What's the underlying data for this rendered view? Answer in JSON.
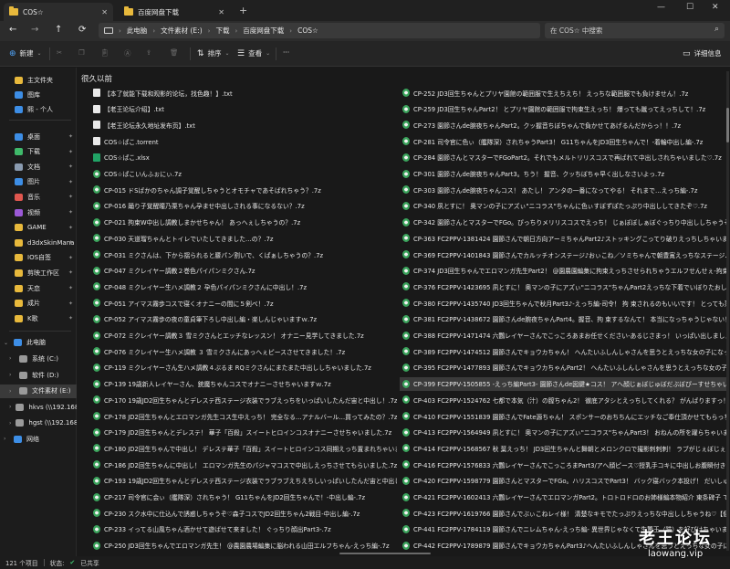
{
  "tabs": [
    {
      "label": "COS☆",
      "active": true
    },
    {
      "label": "百度网盘下载",
      "active": false
    }
  ],
  "window_controls": {
    "minimize": "—",
    "maximize": "☐",
    "close": "✕"
  },
  "nav": {
    "back": "←",
    "forward": "→",
    "up": "↑",
    "refresh": "⟳"
  },
  "breadcrumb": [
    "此电脑",
    "文件素材 (E:)",
    "下载",
    "百度网盘下载",
    "COS☆"
  ],
  "search": {
    "placeholder": "在 COS☆ 中搜索"
  },
  "commands": {
    "new": "新建",
    "sort": "排序",
    "view": "查看",
    "more": "···",
    "details": "详细信息"
  },
  "sidebar": {
    "quick": [
      {
        "label": "主文件夹",
        "icon": "home-icon",
        "color": "#e8b93c"
      },
      {
        "label": "图库",
        "icon": "gallery-icon",
        "color": "#3d8ee6"
      },
      {
        "label": "熙 - 个人",
        "icon": "onedrive-icon",
        "color": "#3d8ee6"
      }
    ],
    "pinned": [
      {
        "label": "桌面",
        "icon": "desktop-icon",
        "color": "#3d8ee6"
      },
      {
        "label": "下载",
        "icon": "download-icon",
        "color": "#3fb96a"
      },
      {
        "label": "文档",
        "icon": "documents-icon",
        "color": "#8a9bb0"
      },
      {
        "label": "图片",
        "icon": "pictures-icon",
        "color": "#3d8ee6"
      },
      {
        "label": "音乐",
        "icon": "music-icon",
        "color": "#e0574f"
      },
      {
        "label": "视频",
        "icon": "videos-icon",
        "color": "#9b59d6"
      },
      {
        "label": "GAME",
        "icon": "folder-icon",
        "color": "#e8b93c"
      },
      {
        "label": "d3dxSkinMana",
        "icon": "folder-icon",
        "color": "#e8b93c"
      },
      {
        "label": "IOS自签",
        "icon": "folder-icon",
        "color": "#e8b93c"
      },
      {
        "label": "剪映工作区",
        "icon": "folder-icon",
        "color": "#e8b93c"
      },
      {
        "label": "天恋",
        "icon": "folder-icon",
        "color": "#e8b93c"
      },
      {
        "label": "成片",
        "icon": "folder-icon",
        "color": "#e8b93c"
      },
      {
        "label": "K歌",
        "icon": "folder-icon",
        "color": "#e8b93c"
      }
    ],
    "devices": [
      {
        "label": "此电脑",
        "icon": "pc-icon",
        "color": "#3d8ee6",
        "expanded": true
      },
      {
        "label": "系统 (C:)",
        "icon": "drive-icon",
        "color": "#9a9a9a"
      },
      {
        "label": "软件 (D:)",
        "icon": "drive-icon",
        "color": "#9a9a9a"
      },
      {
        "label": "文件素材 (E:)",
        "icon": "drive-icon",
        "color": "#9a9a9a",
        "selected": true
      },
      {
        "label": "hkvs (\\\\192.168.",
        "icon": "network-drive-icon",
        "color": "#9a9a9a"
      },
      {
        "label": "hgst (\\\\192.168.",
        "icon": "network-drive-icon",
        "color": "#9a9a9a"
      },
      {
        "label": "网络",
        "icon": "network-icon",
        "color": "#3d8ee6"
      }
    ]
  },
  "group_header": "很久以前",
  "files_left": [
    {
      "name": "【本了就能下载和观影的论坛，找色趣！】.txt",
      "type": "doc"
    },
    {
      "name": "【老王论坛介绍】.txt",
      "type": "doc"
    },
    {
      "name": "【老王论坛永久地址发布页】.txt",
      "type": "doc"
    },
    {
      "name": "COS☆ぱこ.torrent",
      "type": "doc"
    },
    {
      "name": "COS☆ぱこ.xlsx",
      "type": "xlsx"
    },
    {
      "name": "COS☆ぱこいんふぉにぃ.7z",
      "type": "gear"
    },
    {
      "name": "CP-015 ドSばかのちゃん調子覚醒しちゃうとオモチャであそばれちゃう？.7z",
      "type": "gear"
    },
    {
      "name": "CP-016 踊り子覚醒瞳乃栗ちゃん孕ませ中出しされる事になるない？.7z",
      "type": "gear"
    },
    {
      "name": "CP-021 拘束W中出し調教しまかせちゃん！ あっへぇしちゃうの？.7z",
      "type": "gear"
    },
    {
      "name": "CP-030 天道瑠ちゃんとトイレでいたしてきました…の？.7z",
      "type": "gear"
    },
    {
      "name": "CP-031 ミクさんは、下から揺られると腰パン割いで、くぱぁしちゃうの？.7z",
      "type": "gear"
    },
    {
      "name": "CP-047 ミクレイヤー調教２巻色パイパンミクさん.7z",
      "type": "gear"
    },
    {
      "name": "CP-048 ミクレイヤー生ハメ調教２ 孕色パイパンミクさんに中出し！.7z",
      "type": "gear"
    },
    {
      "name": "CP-051 アイマス霧歩コスで寝くオナニーの間に５剣べ！.7z",
      "type": "gear"
    },
    {
      "name": "CP-052 アイマス霧歩の夜の童貞筆下ろし中出し編・楽しんじゃいますｗ.7z",
      "type": "gear"
    },
    {
      "name": "CP-072 ミクレイヤー調教３ 雪ミクさんとエッチなレッスン！ オナニー見学してきました.7z",
      "type": "gear"
    },
    {
      "name": "CP-076 ミクレイヤー生ハメ調教 ３ 雪ミクさんにあっへぇピースさせてきました！.7z",
      "type": "gear"
    },
    {
      "name": "CP-119 ミクレイヤーさん生ハメ調教４ぶるま RQミクさんにまたまた中出ししちゃいました.7z",
      "type": "gear"
    },
    {
      "name": "CP-139 19歳新人レイヤーさん、銃魔ちゃんコスでオナニーさせちゃいますｗ.7z",
      "type": "gear"
    },
    {
      "name": "CP-170 19歳JD2回生ちゃんとデレステ西ステージ衣装でラブえっちをいっぱいしたんだ宙と中出し！.7z",
      "type": "gear"
    },
    {
      "name": "CP-178 JD2回生ちゃんとエロマンガ先生コス生中えっち！ 完全なる…アナルバール…買ってみたの？.7z",
      "type": "gear"
    },
    {
      "name": "CP-179 JD2回生ちゃんとデレステ！ 華子「百殺」スイートヒロインコスオナニーさせちゃいました.7z",
      "type": "gear"
    },
    {
      "name": "CP-180 JD2回生ちゃんで中出し！ デレステ華子「百殺」スイートヒロインコス同期えっち置まれちゃいました.7z",
      "type": "gear"
    },
    {
      "name": "CP-186 JD2回生ちゃんに中出し！ エロマンガ先生のパジャマコスで中出しえっちさせてもらいました.7z",
      "type": "gear"
    },
    {
      "name": "CP-193 19歳JD2回生ちゃんとデレステ西ステージ衣装でラブラブえちえちしいっぱいしたんだ宙と中出し-Part2-1 .7z",
      "type": "gear"
    },
    {
      "name": "CP-217 司令官に会ぃ（艦隊深）されちゃう！ G11ちゃんをJD2回生ちゃんで！-中出し編-.7z",
      "type": "gear"
    },
    {
      "name": "CP-230 スク水中に仕込んで誘惑しちゃうぞ♡森子コスでJD2回生ちゃん2戦目-中出し編-.7z",
      "type": "gear"
    },
    {
      "name": "CP-233 イってる山風ちゃん酒かせて遊ばせて来ました！ ぐっちり顔出Part3-.7z",
      "type": "gear"
    },
    {
      "name": "CP-250 JD3回生ちゃんでエロマンガ先生！ @農園農場編集に脳われる山田エルフちゃん-えっち編-.7z",
      "type": "gear"
    }
  ],
  "files_right": [
    {
      "name": "CP-252 JD3回生ちゃんとプリヤ園館の範囲服で生えちえち！ えっちな範囲服でも負けません！.7z",
      "type": "gear"
    },
    {
      "name": "CP-259 JD3回生ちゃんPart2！ とプリヤ園館の範囲服で拘束生えっち！ 爆っても蹴ってえっちして！.7z",
      "type": "gear"
    },
    {
      "name": "CP-273 園節さんde腕夜ちゃんPart2。クッ握音ちぼちゃんで負かせてあげるんだからっ！！.7z",
      "type": "gear"
    },
    {
      "name": "CP-281 司令官に色ぃ（艦隊深）されちゃうPart3！ G11ちゃんをJD3回生ちゃんで！-着輪中出し編-.7z",
      "type": "gear"
    },
    {
      "name": "CP-284 園節さんとマスターでFGoPart2。それでもメルトリリスコスで再ばれて中出しされちゃいました♡.7z",
      "type": "gear"
    },
    {
      "name": "CP-301 園節さんde腕夜ちゃんPart3。ちう！ 握音、クッちぼちゃ早く出しなさいよっ.7z",
      "type": "gear"
    },
    {
      "name": "CP-303 園節さんde腕夜ちゃんコス！ あたし！ アンタの一番になってやる！ それまで…えっち編-.7z",
      "type": "gear"
    },
    {
      "name": "CP-340 夙とすに！ 奥マンの子にアズぃ\"ニコラス\"ちゃんに色ぃすぼずぽたっぷり中出ししてきたぞ♡.7z",
      "type": "gear"
    },
    {
      "name": "CP-342 園節さんとマスターでFGo。ぴっちりメリリスコスでえっち！ じぁぼぼしぁぼぐっちり中出ししちゃうぞ♡.7z",
      "type": "gear"
    },
    {
      "name": "CP-363 FC2PPV-1381424 園節さんで朝日方向アーミちゃんPart2♪ストッキングこってり破りえっちしちゃいまし",
      "type": "gear"
    },
    {
      "name": "CP-369 FC2PPV-1401843 園節さんでカルッチオンステージ♪おぃこね／ソミちゃんで朝豊寛えっちなステージ♪【個人",
      "type": "gear"
    },
    {
      "name": "CP-374 JD3回生ちゃんでエロマンガ先生Part2！ @園農園編集に拘束えっちさせられちゃうエルフせんせぇ-拘束中出し",
      "type": "gear"
    },
    {
      "name": "CP-376 FC2PPV-1423695 夙とすに！ 奥マンの子にアズぃ\"ニコラス\"ちゃんPart2えっちな下着でいぼりたおして中出",
      "type": "gear"
    },
    {
      "name": "CP-380 FC2PPV-1435740 JD3回生ちゃんで秋月Part3♪-えっち編-司令！ 拘 束されるのもいいです！ とっても蒸れちゃいます",
      "type": "gear"
    },
    {
      "name": "CP-381 FC2PPV-1438672 園節さんde腕夜ちゃんPart4。握音、拘 束するなんて！ 本当になっちゃうじゃない！ 【個人撮",
      "type": "gear"
    },
    {
      "name": "CP-388 FC2PPV-1471474 六鸚レイヤーさんでこっころあまお任せください-あるじさまっ！ いっぱい出しましょうね",
      "type": "gear"
    },
    {
      "name": "CP-389 FC2PPV-1474512 園節さんでキョウカちゃん！ へんたいふしんしゃさんを思うとえっちな女の子になっちゃう",
      "type": "gear"
    },
    {
      "name": "CP-395 FC2PPV-1477893 園節さんでキョウカちゃんPart2！ へんたいふしんしゃさんを思うとえっちな女の子になっちゃう",
      "type": "gear"
    },
    {
      "name": "CP-399 FC2PPV-1505855 -えっち編Part3- 園節さんde図鍵★コス！ アへ顔じぁぼじゅぼだぶぼぴーすせちゃいます",
      "type": "gear",
      "selected": true
    },
    {
      "name": "CP-403 FC2PPV-1524762 七都で本気（汁）の膣ちゃん2！ 徹底アタシとえっちしてくれる？ がんばりますっ！ キャラ",
      "type": "gear"
    },
    {
      "name": "CP-410 FC2PPV-1551839 園節さんでFate源ちゃん！ スポンサーのおちちんにエッチなご奉仕頂かせてもらっちゃいます",
      "type": "gear"
    },
    {
      "name": "CP-413 FC2PPV-1564949 夙とすに！ 奥マンの子にアズぃ\"ニコラス\"ちゃんPart3！ おねんの所を躍らちゃいました",
      "type": "gear"
    },
    {
      "name": "CP-414 FC2PPV-1568567 秋 葉えっち！ JD3回生ちゃんと舞朝とメロンクロで撮影刺刺刺！ ラブがじぇぼじぇぽ抜け出しちゃい",
      "type": "gear"
    },
    {
      "name": "CP-416 FC2PPV-1576833 六鸚レイヤーさんでこっころまPart3/アへ顔ピース♡授乳手コキに中出しお腹瞬付き【個人",
      "type": "gear"
    },
    {
      "name": "CP-420 FC2PPV-1598779 園節さんとマスターでFGo。ハリスコスでPart3！ バック寝バック本投げ！ だいしゅきホールドで中",
      "type": "gear"
    },
    {
      "name": "CP-421 FC2PPV-1602413 六鸚レイヤーさんでエロマンガPart2。トロトロドロのお姉様編本物紹介 東条碑子 でずこぼこ豚志です",
      "type": "gear"
    },
    {
      "name": "CP-423 FC2PPV-1619766 園節さんでぶぃこねレイ様！ 清楚なキモでたっぷりえっちな中出ししちゃうね♡【個人撮影】",
      "type": "gear"
    },
    {
      "name": "CP-441 FC2PPV-1784119 園節さんでニレムちゃん-えっち編- 異世界じゃなくて生驚王（猫）を好ぴはちゃいます！ 5",
      "type": "gear"
    },
    {
      "name": "CP-442 FC2PPV-1789879 園節さんでキョウカちゃんPart3♪へんたいふしんしゃさんを思うとえっちな女の子に",
      "type": "gear"
    }
  ],
  "status": {
    "count": "121 个项目",
    "state_label": "状态:",
    "state_value": "已共享"
  },
  "watermark": {
    "title": "老王论坛",
    "url": "laowang.vip"
  }
}
